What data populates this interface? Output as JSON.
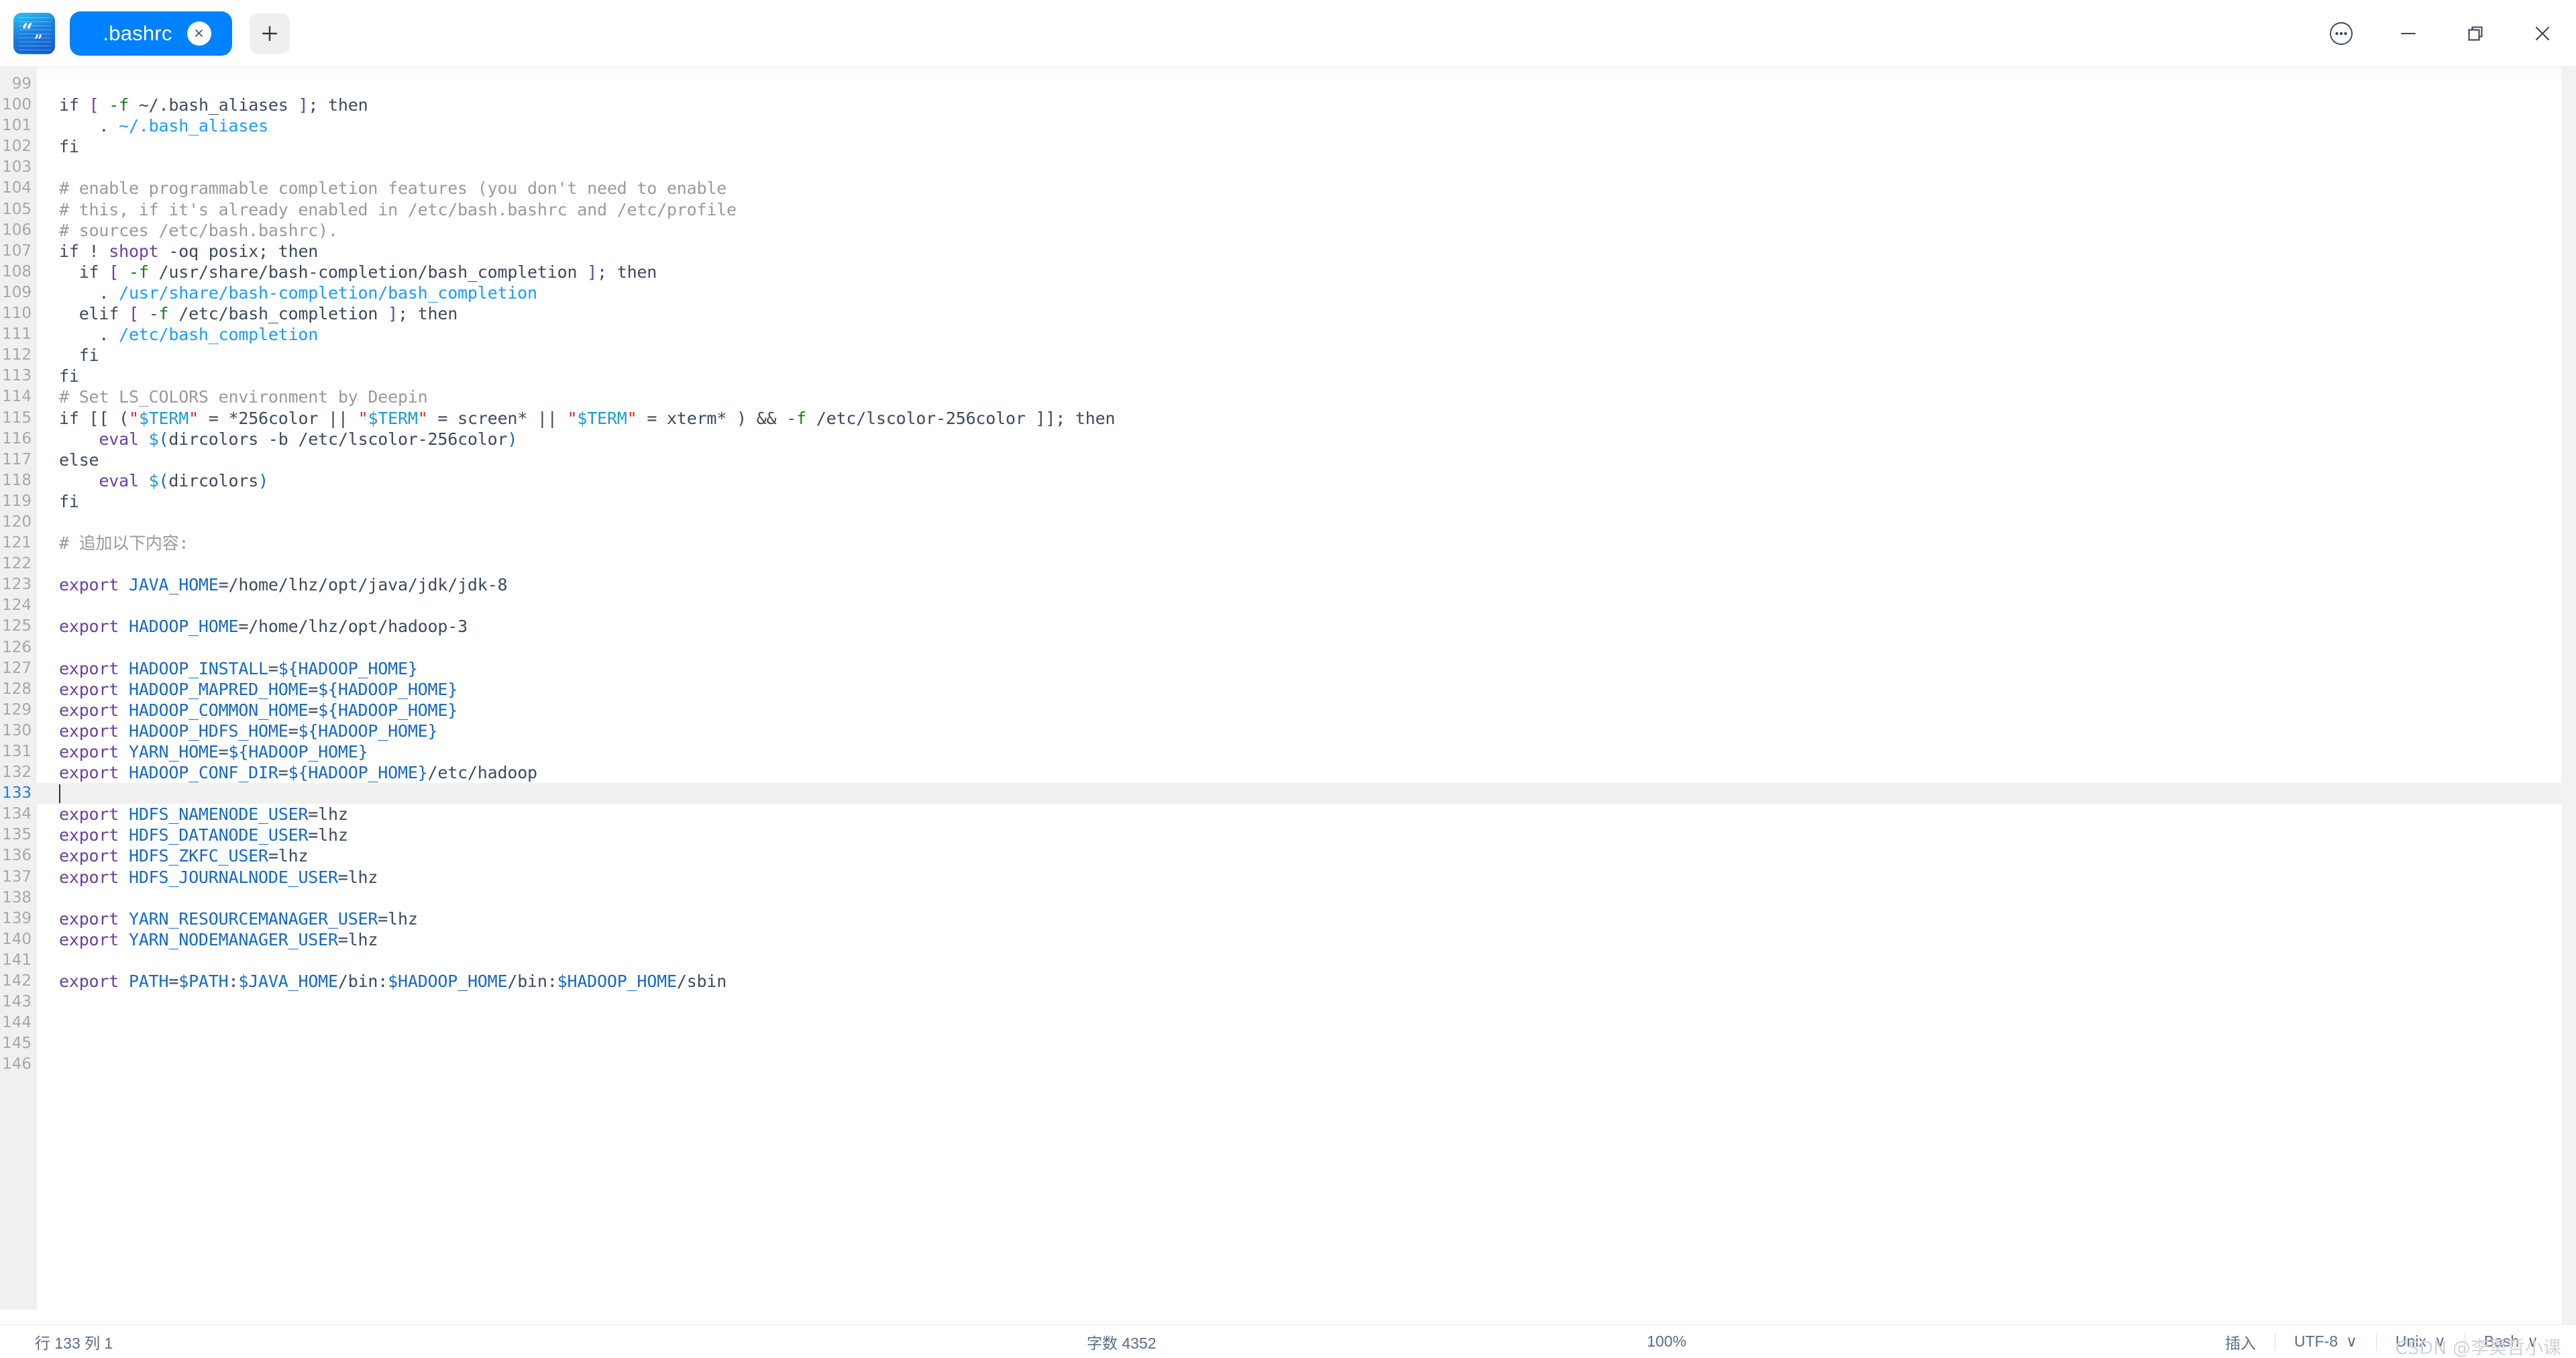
{
  "window": {
    "app_icon": "notes-app-icon",
    "tabs": [
      {
        "label": ".bashrc",
        "active": true,
        "close_icon": "close-icon"
      }
    ],
    "new_tab_icon": "plus-icon",
    "controls": {
      "menu_icon": "more-options-icon",
      "minimize_icon": "minimize-icon",
      "maximize_icon": "maximize-icon",
      "close_icon": "window-close-icon"
    }
  },
  "editor": {
    "first_line_number": 99,
    "last_line_number": 146,
    "active_line": 133,
    "cursor_column": 1,
    "lines": [
      {
        "n": 99,
        "tokens": []
      },
      {
        "n": 100,
        "tokens": [
          {
            "t": "if ",
            "c": "txt"
          },
          {
            "t": "[",
            "c": "brk"
          },
          {
            "t": " ",
            "c": "txt"
          },
          {
            "t": "-f",
            "c": "flag"
          },
          {
            "t": " ~/.bash_aliases ",
            "c": "txt"
          },
          {
            "t": "]",
            "c": "brk"
          },
          {
            "t": "; then",
            "c": "txt"
          }
        ]
      },
      {
        "n": 101,
        "tokens": [
          {
            "t": "    . ",
            "c": "txt"
          },
          {
            "t": "~/.bash_aliases",
            "c": "path"
          }
        ]
      },
      {
        "n": 102,
        "tokens": [
          {
            "t": "fi",
            "c": "txt"
          }
        ]
      },
      {
        "n": 103,
        "tokens": []
      },
      {
        "n": 104,
        "tokens": [
          {
            "t": "# enable programmable completion features (you don't need to enable",
            "c": "cmt"
          }
        ]
      },
      {
        "n": 105,
        "tokens": [
          {
            "t": "# this, if it's already enabled in /etc/bash.bashrc and /etc/profile",
            "c": "cmt"
          }
        ]
      },
      {
        "n": 106,
        "tokens": [
          {
            "t": "# sources /etc/bash.bashrc).",
            "c": "cmt"
          }
        ]
      },
      {
        "n": 107,
        "tokens": [
          {
            "t": "if ! ",
            "c": "txt"
          },
          {
            "t": "shopt",
            "c": "kw"
          },
          {
            "t": " -oq posix; then",
            "c": "txt"
          }
        ]
      },
      {
        "n": 108,
        "tokens": [
          {
            "t": "  if ",
            "c": "txt"
          },
          {
            "t": "[",
            "c": "brk"
          },
          {
            "t": " ",
            "c": "txt"
          },
          {
            "t": "-f",
            "c": "flag"
          },
          {
            "t": " /usr/share/bash-completion/bash_completion ",
            "c": "txt"
          },
          {
            "t": "]",
            "c": "brk"
          },
          {
            "t": "; then",
            "c": "txt"
          }
        ]
      },
      {
        "n": 109,
        "tokens": [
          {
            "t": "    . ",
            "c": "txt"
          },
          {
            "t": "/usr/share/bash-completion/bash_completion",
            "c": "path"
          }
        ]
      },
      {
        "n": 110,
        "tokens": [
          {
            "t": "  elif ",
            "c": "txt"
          },
          {
            "t": "[",
            "c": "brk"
          },
          {
            "t": " ",
            "c": "txt"
          },
          {
            "t": "-f",
            "c": "flag"
          },
          {
            "t": " /etc/bash_completion ",
            "c": "txt"
          },
          {
            "t": "]",
            "c": "brk"
          },
          {
            "t": "; then",
            "c": "txt"
          }
        ]
      },
      {
        "n": 111,
        "tokens": [
          {
            "t": "    . ",
            "c": "txt"
          },
          {
            "t": "/etc/bash_completion",
            "c": "path"
          }
        ]
      },
      {
        "n": 112,
        "tokens": [
          {
            "t": "  fi",
            "c": "txt"
          }
        ]
      },
      {
        "n": 113,
        "tokens": [
          {
            "t": "fi",
            "c": "txt"
          }
        ]
      },
      {
        "n": 114,
        "tokens": [
          {
            "t": "# Set LS_COLORS environment by Deepin",
            "c": "cmt"
          }
        ]
      },
      {
        "n": 115,
        "tokens": [
          {
            "t": "if [[ (",
            "c": "txt"
          },
          {
            "t": "\"",
            "c": "quote"
          },
          {
            "t": "$TERM",
            "c": "str"
          },
          {
            "t": "\"",
            "c": "quote"
          },
          {
            "t": " = *256color || ",
            "c": "txt"
          },
          {
            "t": "\"",
            "c": "quote"
          },
          {
            "t": "$TERM",
            "c": "str"
          },
          {
            "t": "\"",
            "c": "quote"
          },
          {
            "t": " = screen* || ",
            "c": "txt"
          },
          {
            "t": "\"",
            "c": "quote"
          },
          {
            "t": "$TERM",
            "c": "str"
          },
          {
            "t": "\"",
            "c": "quote"
          },
          {
            "t": " = xterm* ) && ",
            "c": "txt"
          },
          {
            "t": "-f",
            "c": "flag"
          },
          {
            "t": " /etc/lscolor-256color ]]; then",
            "c": "txt"
          }
        ]
      },
      {
        "n": 116,
        "tokens": [
          {
            "t": "    ",
            "c": "txt"
          },
          {
            "t": "eval",
            "c": "kw"
          },
          {
            "t": " ",
            "c": "txt"
          },
          {
            "t": "$",
            "c": "dollar"
          },
          {
            "t": "(",
            "c": "paren"
          },
          {
            "t": "dircolors -b /etc/lscolor-256color",
            "c": "txt"
          },
          {
            "t": ")",
            "c": "paren"
          }
        ]
      },
      {
        "n": 117,
        "tokens": [
          {
            "t": "else",
            "c": "txt"
          }
        ]
      },
      {
        "n": 118,
        "tokens": [
          {
            "t": "    ",
            "c": "txt"
          },
          {
            "t": "eval",
            "c": "kw"
          },
          {
            "t": " ",
            "c": "txt"
          },
          {
            "t": "$",
            "c": "dollar"
          },
          {
            "t": "(",
            "c": "paren"
          },
          {
            "t": "dircolors",
            "c": "txt"
          },
          {
            "t": ")",
            "c": "paren"
          }
        ]
      },
      {
        "n": 119,
        "tokens": [
          {
            "t": "fi",
            "c": "txt"
          }
        ]
      },
      {
        "n": 120,
        "tokens": []
      },
      {
        "n": 121,
        "tokens": [
          {
            "t": "# 追加以下内容:",
            "c": "cmt"
          }
        ]
      },
      {
        "n": 122,
        "tokens": []
      },
      {
        "n": 123,
        "tokens": [
          {
            "t": "export",
            "c": "kw"
          },
          {
            "t": " ",
            "c": "txt"
          },
          {
            "t": "JAVA_HOME",
            "c": "var"
          },
          {
            "t": "=/home/lhz/opt/java/jdk/jdk-8",
            "c": "txt"
          }
        ]
      },
      {
        "n": 124,
        "tokens": []
      },
      {
        "n": 125,
        "tokens": [
          {
            "t": "export",
            "c": "kw"
          },
          {
            "t": " ",
            "c": "txt"
          },
          {
            "t": "HADOOP_HOME",
            "c": "var"
          },
          {
            "t": "=/home/lhz/opt/hadoop-3",
            "c": "txt"
          }
        ]
      },
      {
        "n": 126,
        "tokens": []
      },
      {
        "n": 127,
        "tokens": [
          {
            "t": "export",
            "c": "kw"
          },
          {
            "t": " ",
            "c": "txt"
          },
          {
            "t": "HADOOP_INSTALL",
            "c": "var"
          },
          {
            "t": "=",
            "c": "txt"
          },
          {
            "t": "${HADOOP_HOME}",
            "c": "var"
          }
        ]
      },
      {
        "n": 128,
        "tokens": [
          {
            "t": "export",
            "c": "kw"
          },
          {
            "t": " ",
            "c": "txt"
          },
          {
            "t": "HADOOP_MAPRED_HOME",
            "c": "var"
          },
          {
            "t": "=",
            "c": "txt"
          },
          {
            "t": "${HADOOP_HOME}",
            "c": "var"
          }
        ]
      },
      {
        "n": 129,
        "tokens": [
          {
            "t": "export",
            "c": "kw"
          },
          {
            "t": " ",
            "c": "txt"
          },
          {
            "t": "HADOOP_COMMON_HOME",
            "c": "var"
          },
          {
            "t": "=",
            "c": "txt"
          },
          {
            "t": "${HADOOP_HOME}",
            "c": "var"
          }
        ]
      },
      {
        "n": 130,
        "tokens": [
          {
            "t": "export",
            "c": "kw"
          },
          {
            "t": " ",
            "c": "txt"
          },
          {
            "t": "HADOOP_HDFS_HOME",
            "c": "var"
          },
          {
            "t": "=",
            "c": "txt"
          },
          {
            "t": "${HADOOP_HOME}",
            "c": "var"
          }
        ]
      },
      {
        "n": 131,
        "tokens": [
          {
            "t": "export",
            "c": "kw"
          },
          {
            "t": " ",
            "c": "txt"
          },
          {
            "t": "YARN_HOME",
            "c": "var"
          },
          {
            "t": "=",
            "c": "txt"
          },
          {
            "t": "${HADOOP_HOME}",
            "c": "var"
          }
        ]
      },
      {
        "n": 132,
        "tokens": [
          {
            "t": "export",
            "c": "kw"
          },
          {
            "t": " ",
            "c": "txt"
          },
          {
            "t": "HADOOP_CONF_DIR",
            "c": "var"
          },
          {
            "t": "=",
            "c": "txt"
          },
          {
            "t": "${HADOOP_HOME}",
            "c": "var"
          },
          {
            "t": "/etc/hadoop",
            "c": "txt"
          }
        ]
      },
      {
        "n": 133,
        "tokens": []
      },
      {
        "n": 134,
        "tokens": [
          {
            "t": "export",
            "c": "kw"
          },
          {
            "t": " ",
            "c": "txt"
          },
          {
            "t": "HDFS_NAMENODE_USER",
            "c": "var"
          },
          {
            "t": "=lhz",
            "c": "txt"
          }
        ]
      },
      {
        "n": 135,
        "tokens": [
          {
            "t": "export",
            "c": "kw"
          },
          {
            "t": " ",
            "c": "txt"
          },
          {
            "t": "HDFS_DATANODE_USER",
            "c": "var"
          },
          {
            "t": "=lhz",
            "c": "txt"
          }
        ]
      },
      {
        "n": 136,
        "tokens": [
          {
            "t": "export",
            "c": "kw"
          },
          {
            "t": " ",
            "c": "txt"
          },
          {
            "t": "HDFS_ZKFC_USER",
            "c": "var"
          },
          {
            "t": "=lhz",
            "c": "txt"
          }
        ]
      },
      {
        "n": 137,
        "tokens": [
          {
            "t": "export",
            "c": "kw"
          },
          {
            "t": " ",
            "c": "txt"
          },
          {
            "t": "HDFS_JOURNALNODE_USER",
            "c": "var"
          },
          {
            "t": "=lhz",
            "c": "txt"
          }
        ]
      },
      {
        "n": 138,
        "tokens": []
      },
      {
        "n": 139,
        "tokens": [
          {
            "t": "export",
            "c": "kw"
          },
          {
            "t": " ",
            "c": "txt"
          },
          {
            "t": "YARN_RESOURCEMANAGER_USER",
            "c": "var"
          },
          {
            "t": "=lhz",
            "c": "txt"
          }
        ]
      },
      {
        "n": 140,
        "tokens": [
          {
            "t": "export",
            "c": "kw"
          },
          {
            "t": " ",
            "c": "txt"
          },
          {
            "t": "YARN_NODEMANAGER_USER",
            "c": "var"
          },
          {
            "t": "=lhz",
            "c": "txt"
          }
        ]
      },
      {
        "n": 141,
        "tokens": []
      },
      {
        "n": 142,
        "tokens": [
          {
            "t": "export",
            "c": "kw"
          },
          {
            "t": " ",
            "c": "txt"
          },
          {
            "t": "PATH",
            "c": "var"
          },
          {
            "t": "=",
            "c": "txt"
          },
          {
            "t": "$PATH",
            "c": "var"
          },
          {
            "t": ":",
            "c": "txt"
          },
          {
            "t": "$JAVA_HOME",
            "c": "var"
          },
          {
            "t": "/bin",
            "c": "txt"
          },
          {
            "t": ":",
            "c": "txt"
          },
          {
            "t": "$HADOOP_HOME",
            "c": "var"
          },
          {
            "t": "/bin",
            "c": "txt"
          },
          {
            "t": ":",
            "c": "txt"
          },
          {
            "t": "$HADOOP_HOME",
            "c": "var"
          },
          {
            "t": "/sbin",
            "c": "txt"
          }
        ]
      },
      {
        "n": 143,
        "tokens": []
      },
      {
        "n": 144,
        "tokens": []
      },
      {
        "n": 145,
        "tokens": []
      },
      {
        "n": 146,
        "tokens": []
      }
    ]
  },
  "statusbar": {
    "position": "行 133 列 1",
    "word_count": "字数 4352",
    "zoom": "100%",
    "insert_mode": "插入",
    "encoding": "UTF-8",
    "line_ending": "Unix",
    "language": "Bash",
    "chevron": "∨",
    "watermark": "CSDN @李昊哲小课"
  },
  "colors": {
    "accent": "#0081ff",
    "keyword": "#6a3fa0",
    "variable": "#1669c5",
    "comment": "#9a9a9a",
    "string": "#1f9ad6",
    "quote": "#cc2b2b",
    "flag": "#1d7a1d",
    "path": "#1a9bff",
    "gutter_bg": "#f0f0f0",
    "active_line_bg": "#f0f0f0"
  }
}
